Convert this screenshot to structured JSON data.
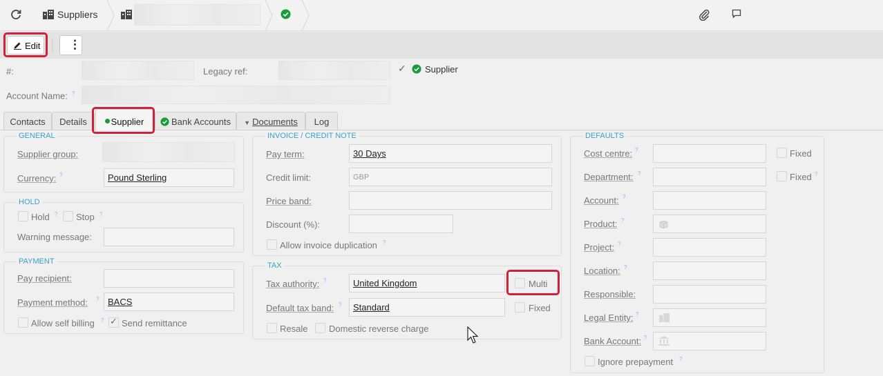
{
  "breadcrumb": {
    "suppliers_label": "Suppliers"
  },
  "toolbar": {
    "edit_label": "Edit",
    "more_label": "⋮"
  },
  "header": {
    "number_label": "#:",
    "legacy_ref_label": "Legacy ref:",
    "supplier_flag_label": "Supplier",
    "account_name_label": "Account Name:"
  },
  "tabs": [
    {
      "label": "Contacts"
    },
    {
      "label": "Details"
    },
    {
      "label": "Supplier"
    },
    {
      "label": "Bank Accounts"
    },
    {
      "label": "Documents"
    },
    {
      "label": "Log"
    }
  ],
  "general": {
    "title": "GENERAL",
    "supplier_group_label": "Supplier group:",
    "currency_label": "Currency:",
    "currency_value": "Pound Sterling"
  },
  "hold": {
    "title": "HOLD",
    "hold_label": "Hold",
    "stop_label": "Stop",
    "warning_label": "Warning message:"
  },
  "payment": {
    "title": "PAYMENT",
    "pay_recipient_label": "Pay recipient:",
    "payment_method_label": "Payment method:",
    "payment_method_value": "BACS",
    "allow_self_billing_label": "Allow self billing",
    "send_remittance_label": "Send remittance"
  },
  "invoice": {
    "title": "INVOICE / CREDIT NOTE",
    "pay_term_label": "Pay term:",
    "pay_term_value": "30 Days",
    "credit_limit_label": "Credit limit:",
    "credit_limit_placeholder": "GBP",
    "price_band_label": "Price band:",
    "discount_label": "Discount (%):",
    "allow_dup_label": "Allow invoice duplication"
  },
  "tax": {
    "title": "TAX",
    "tax_authority_label": "Tax authority:",
    "tax_authority_value": "United Kingdom",
    "multi_label": "Multi",
    "default_tax_band_label": "Default tax band:",
    "default_tax_band_value": "Standard",
    "fixed_label": "Fixed",
    "resale_label": "Resale",
    "domestic_reverse_label": "Domestic reverse charge"
  },
  "defaults": {
    "title": "DEFAULTS",
    "cost_centre_label": "Cost centre:",
    "fixed_label_1": "Fixed",
    "department_label": "Department:",
    "fixed_label_2": "Fixed",
    "account_label": "Account:",
    "product_label": "Product:",
    "project_label": "Project:",
    "location_label": "Location:",
    "responsible_label": "Responsible:",
    "legal_entity_label": "Legal Entity:",
    "bank_account_label": "Bank Account:",
    "ignore_prepayment_label": "Ignore prepayment"
  },
  "colors": {
    "accent_blue": "#3aa0c9",
    "highlight_red": "#d0213b",
    "status_green": "#1a9c3a"
  }
}
